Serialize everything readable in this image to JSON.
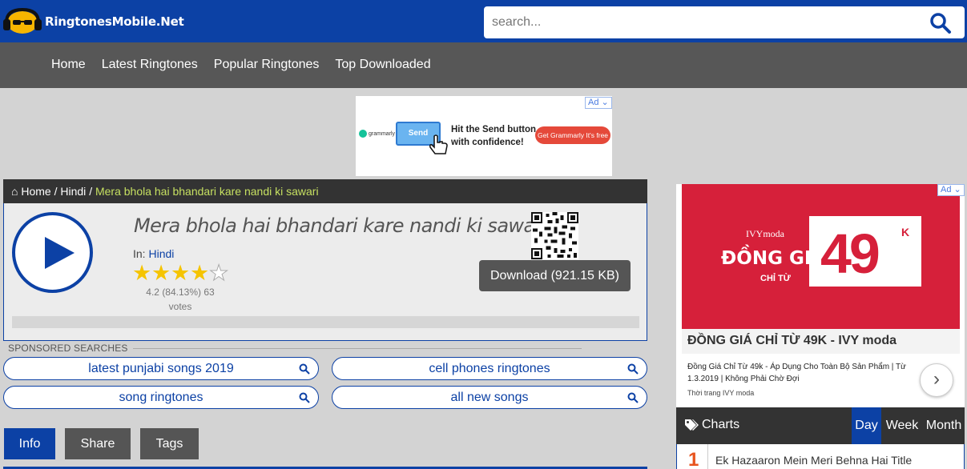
{
  "header": {
    "site_name": "RingtonesMobile.Net",
    "search_placeholder": "search..."
  },
  "nav": {
    "items": [
      {
        "label": "Home"
      },
      {
        "label": "Latest Ringtones"
      },
      {
        "label": "Popular Ringtones"
      },
      {
        "label": "Top Downloaded"
      }
    ]
  },
  "top_ad": {
    "badge": "Ad",
    "brand": "grammarly",
    "button": "Send",
    "headline": "Hit the Send button with confidence!",
    "cta": "Get Grammarly It's free"
  },
  "breadcrumb": {
    "home": "Home",
    "category": "Hindi",
    "current": "Mera bhola hai bhandari kare nandi ki sawari",
    "sep": "/"
  },
  "song": {
    "title": "Mera bhola hai bhandari kare nandi ki sawari",
    "category_label": "In:",
    "category": "Hindi",
    "rating": 4.2,
    "rating_text": "4.2 (84.13%) 63 votes",
    "download_label": "Download (921.15 KB)",
    "progress": 0
  },
  "sponsored": {
    "label": "SPONSORED SEARCHES",
    "items": [
      "latest punjabi songs 2019",
      "cell phones ringtones",
      "song ringtones",
      "all new songs"
    ]
  },
  "tabs": [
    {
      "label": "Info",
      "active": true
    },
    {
      "label": "Share",
      "active": false
    },
    {
      "label": "Tags",
      "active": false
    }
  ],
  "side_ad": {
    "badge": "Ad",
    "brand": "IVYmoda",
    "headline_line1": "ĐỒNG GIÁ",
    "headline_line2": "CHỈ TỪ",
    "price": "49",
    "price_suffix": "K",
    "title": "ĐỒNG GIÁ CHỈ TỪ 49K - IVY moda",
    "description": "Đồng Giá Chỉ Từ 49k - Áp Dụng Cho Toàn Bộ Sản Phẩm | Từ 1.3.2019 | Không Phải Chờ Đợi",
    "source": "Thời trang IVY moda"
  },
  "charts": {
    "title": "Charts",
    "tabs": [
      {
        "label": "Day",
        "active": true
      },
      {
        "label": "Week",
        "active": false
      },
      {
        "label": "Month",
        "active": false
      }
    ],
    "items": [
      {
        "rank": "1",
        "name": "Ek Hazaaron Mein Meri Behna Hai Title"
      }
    ]
  },
  "colors": {
    "brand_blue": "#0c41a5",
    "nav_gray": "#575757",
    "star_gold": "#f5c400",
    "rank_orange": "#e8541e",
    "ad_red": "#d6203a"
  }
}
